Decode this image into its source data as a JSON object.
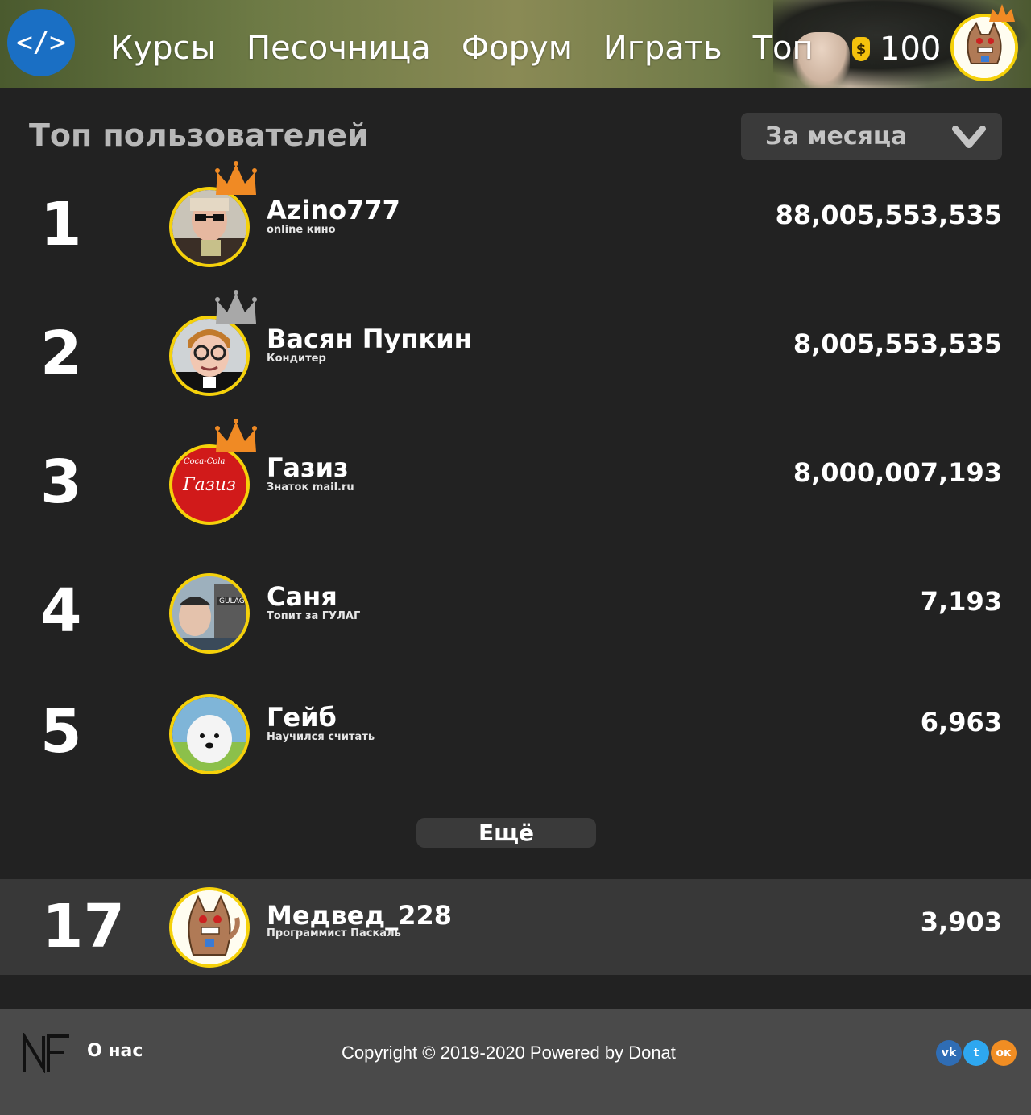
{
  "header": {
    "logo_text": "</>",
    "nav": [
      "Курсы",
      "Песочница",
      "Форум",
      "Играть",
      "Топ"
    ],
    "coin_symbol": "$",
    "coins": "100"
  },
  "page": {
    "title": "Топ пользователей",
    "period_label": "За месяца",
    "more_label": "Ещё"
  },
  "users": [
    {
      "rank": "1",
      "name": "Azino777",
      "status": "online кино",
      "score": "88,005,553,535",
      "crown": "orange"
    },
    {
      "rank": "2",
      "name": "Васян Пупкин",
      "status": "Кондитер",
      "score": "8,005,553,535",
      "crown": "silver"
    },
    {
      "rank": "3",
      "name": "Газиз",
      "status": "Знаток mail.ru",
      "score": "8,000,007,193",
      "crown": "orange",
      "avatar_text": "Газиз",
      "avatar_subtext": "Coca-Cola"
    },
    {
      "rank": "4",
      "name": "Саня",
      "status": "Топит за ГУЛАГ",
      "score": "7,193",
      "avatar_text": "GULAG"
    },
    {
      "rank": "5",
      "name": "Гейб",
      "status": "Научился считать",
      "score": "6,963"
    }
  ],
  "me": {
    "rank": "17",
    "name": "Медвед_228",
    "status": "Программист Паскаль",
    "score": "3,903"
  },
  "footer": {
    "logo": "NF",
    "about": "О нас",
    "copyright": "Copyright © 2019-2020 Powered by Donat",
    "social": [
      {
        "name": "vk-icon",
        "label": "vk",
        "color": "#2f6db5"
      },
      {
        "name": "twitter-icon",
        "label": "t",
        "color": "#2ea7f0"
      },
      {
        "name": "ok-icon",
        "label": "ок",
        "color": "#f08d23"
      }
    ]
  },
  "colors": {
    "crown_orange": "#f08a24",
    "crown_silver": "#a8a8a8",
    "avatar_border": "#f5d10a"
  }
}
